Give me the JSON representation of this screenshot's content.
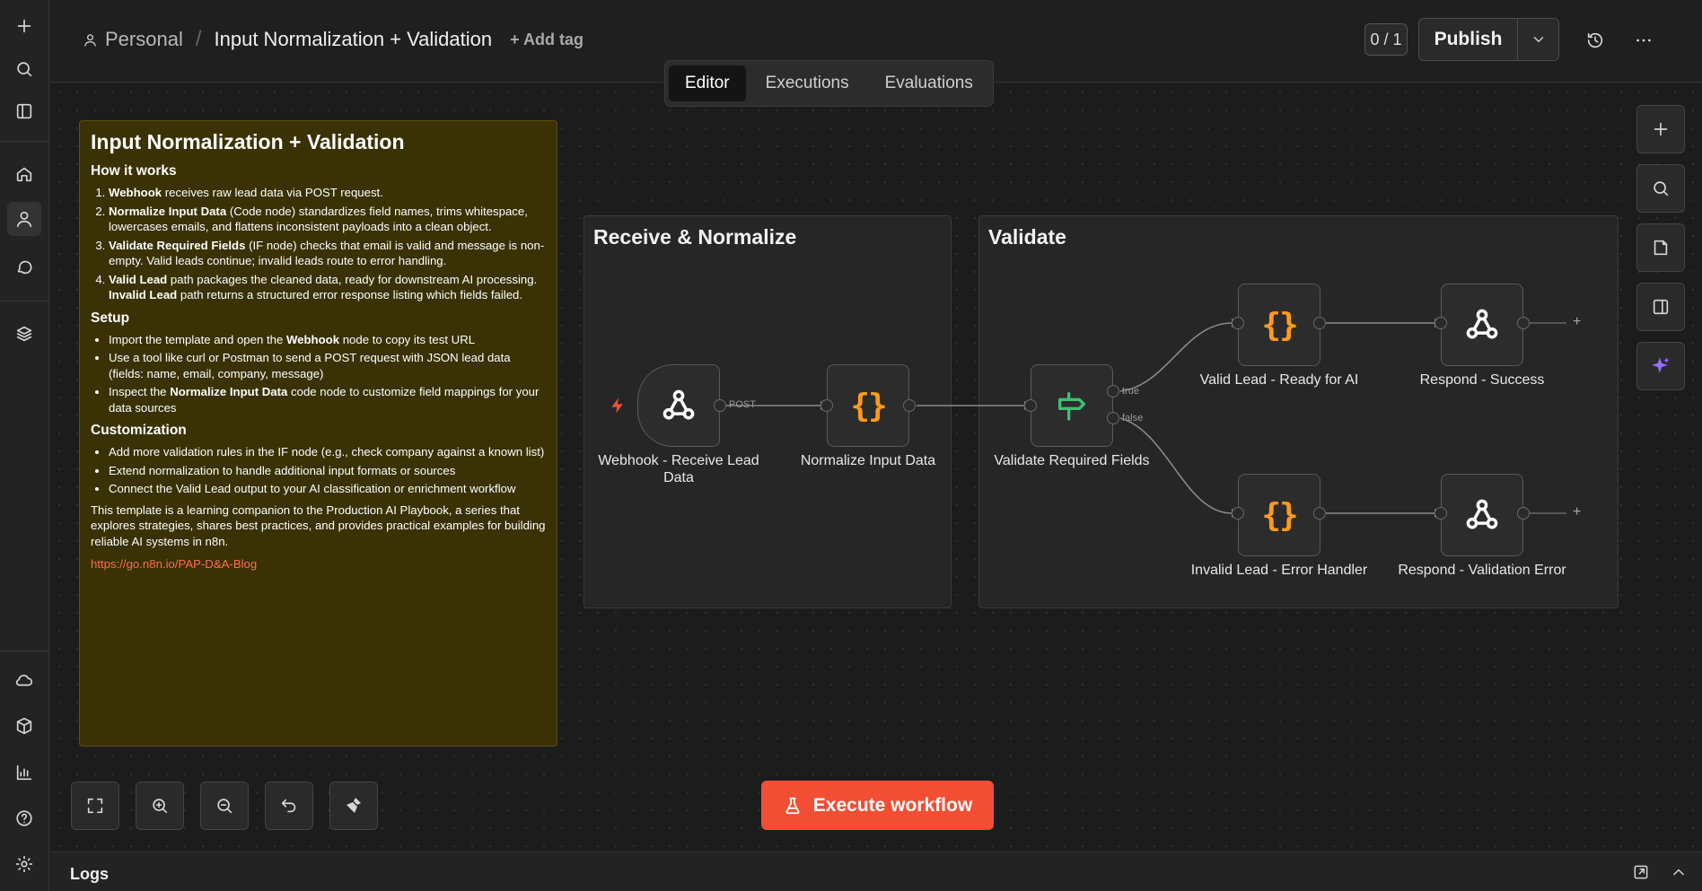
{
  "header": {
    "workspace": "Personal",
    "workflow_name": "Input Normalization + Validation",
    "add_tag": "+ Add tag",
    "counter": "0 / 1",
    "publish": "Publish"
  },
  "tabs": [
    "Editor",
    "Executions",
    "Evaluations"
  ],
  "sticky": {
    "title": "Input Normalization + Validation",
    "how_heading": "How it works",
    "how_items": [
      {
        "bold": "Webhook",
        "text": " receives raw lead data via POST request."
      },
      {
        "bold": "Normalize Input Data",
        "text": " (Code node) standardizes field names, trims whitespace, lowercases emails, and flattens inconsistent payloads into a clean object."
      },
      {
        "bold": "Validate Required Fields",
        "text": " (IF node) checks that email is valid and message is non-empty. Valid leads continue; invalid leads route to error handling."
      },
      {
        "bold": "Valid Lead",
        "text": " path packages the cleaned data, ready for downstream AI processing. ",
        "bold2": "Invalid Lead",
        "text2": " path returns a structured error response listing which fields failed."
      }
    ],
    "setup_heading": "Setup",
    "setup_items": [
      {
        "pre": "Import the template and open the ",
        "bold": "Webhook",
        "post": " node to copy its test URL"
      },
      {
        "pre": "Use a tool like curl or Postman to send a POST request with JSON lead data (fields: name, email, company, message)",
        "bold": "",
        "post": ""
      },
      {
        "pre": "Inspect the ",
        "bold": "Normalize Input Data",
        "post": " code node to customize field mappings for your data sources"
      }
    ],
    "custom_heading": "Customization",
    "custom_items": [
      "Add more validation rules in the IF node (e.g., check company against a known list)",
      "Extend normalization to handle additional input formats or sources",
      "Connect the Valid Lead output to your AI classification or enrichment workflow"
    ],
    "footer": "This template is a learning companion to the Production AI Playbook, a series that explores strategies, shares best practices, and provides practical examples for building reliable AI systems in n8n.",
    "link": "https://go.n8n.io/PAP-D&A-Blog"
  },
  "groups": {
    "receive": "Receive & Normalize",
    "validate": "Validate"
  },
  "nodes": {
    "webhook": "Webhook - Receive Lead Data",
    "normalize": "Normalize Input Data",
    "validate": "Validate Required Fields",
    "valid_lead": "Valid Lead - Ready for AI",
    "respond_success": "Respond - Success",
    "invalid_lead": "Invalid Lead - Error Handler",
    "respond_error": "Respond - Validation Error"
  },
  "port_labels": {
    "post": "POST",
    "true": "true",
    "false": "false"
  },
  "execute": "Execute workflow",
  "logs": "Logs",
  "colors": {
    "accent": "#f24e33",
    "sticky": "#3a3105",
    "code_icon": "#ff9b1a",
    "if_icon": "#3fbf75",
    "ai_icon": "#9a6bff"
  }
}
